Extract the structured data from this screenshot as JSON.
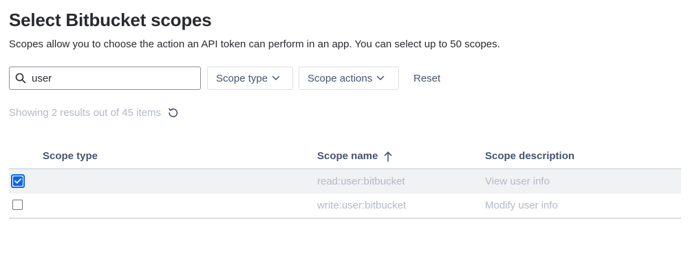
{
  "header": {
    "title": "Select Bitbucket scopes",
    "subtitle": "Scopes allow you to choose the action an API token can perform in an app. You can select up to 50 scopes."
  },
  "filters": {
    "search_value": "user",
    "scope_type_label": "Scope type",
    "scope_actions_label": "Scope actions",
    "reset_label": "Reset"
  },
  "results": {
    "summary": "Showing 2 results out of 45 items"
  },
  "table": {
    "columns": [
      "Scope type",
      "Scope name",
      "Scope description"
    ],
    "sort": {
      "column": "Scope name",
      "direction": "ascending"
    },
    "rows": [
      {
        "checked": true,
        "type": "",
        "name": "read:user:bitbucket",
        "description": "View user info"
      },
      {
        "checked": false,
        "type": "",
        "name": "write:user:bitbucket",
        "description": "Modify user info"
      }
    ]
  },
  "colors": {
    "accent": "#0c66e4",
    "muted_text": "#b3b9c4",
    "selected_row_bg": "#f1f2f4"
  }
}
